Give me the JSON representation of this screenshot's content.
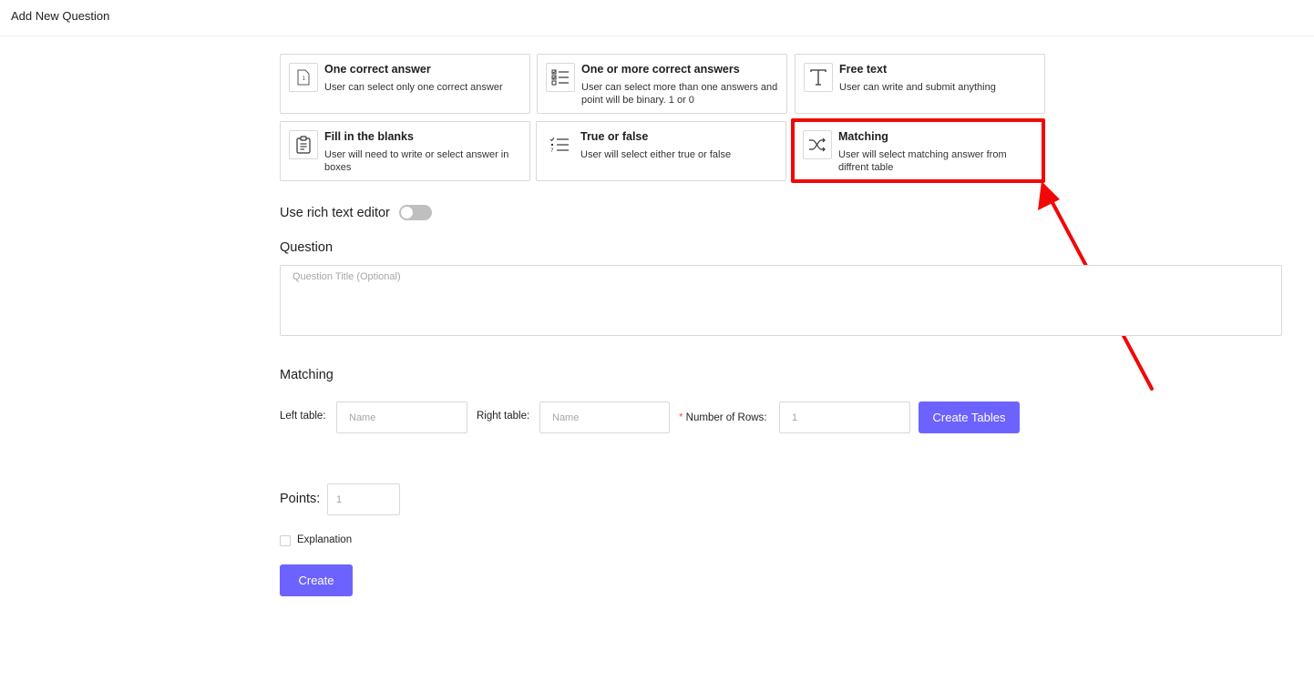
{
  "header": {
    "title": "Add New Question"
  },
  "question_types": [
    {
      "title": "One correct answer",
      "description": "User can select only one correct answer",
      "icon": "single-answer-icon"
    },
    {
      "title": "One or more correct answers",
      "description": "User can select more than one answers and point will be binary. 1 or 0",
      "icon": "multiple-answers-icon"
    },
    {
      "title": "Free text",
      "description": "User can write and submit anything",
      "icon": "text-t-icon"
    },
    {
      "title": "Fill in the blanks",
      "description": "User will need to write or select answer in boxes",
      "icon": "clipboard-icon"
    },
    {
      "title": "True or false",
      "description": "User will select either true or false",
      "icon": "checklist-icon"
    },
    {
      "title": "Matching",
      "description": "User will select matching answer from diffrent table",
      "icon": "shuffle-icon"
    }
  ],
  "annotation": {
    "color": "#f20707",
    "highlighted_item": "Matching"
  },
  "rich_text": {
    "label": "Use rich text editor",
    "enabled": false
  },
  "question": {
    "label": "Question",
    "placeholder": "Question Title (Optional)"
  },
  "matching": {
    "label": "Matching",
    "left_table_label": "Left table",
    "left_table_placeholder": "Name",
    "right_table_label": "Right table",
    "right_table_placeholder": "Name",
    "rows_required_mark": "*",
    "rows_label": "Number of Rows",
    "rows_placeholder": "1",
    "create_tables_label": "Create Tables"
  },
  "points": {
    "label": "Points:",
    "placeholder": "1"
  },
  "explanation": {
    "label": "Explanation",
    "checked": false
  },
  "create_label": "Create",
  "colors": {
    "primary": "#6c63ff",
    "border": "#d9d9d9"
  }
}
